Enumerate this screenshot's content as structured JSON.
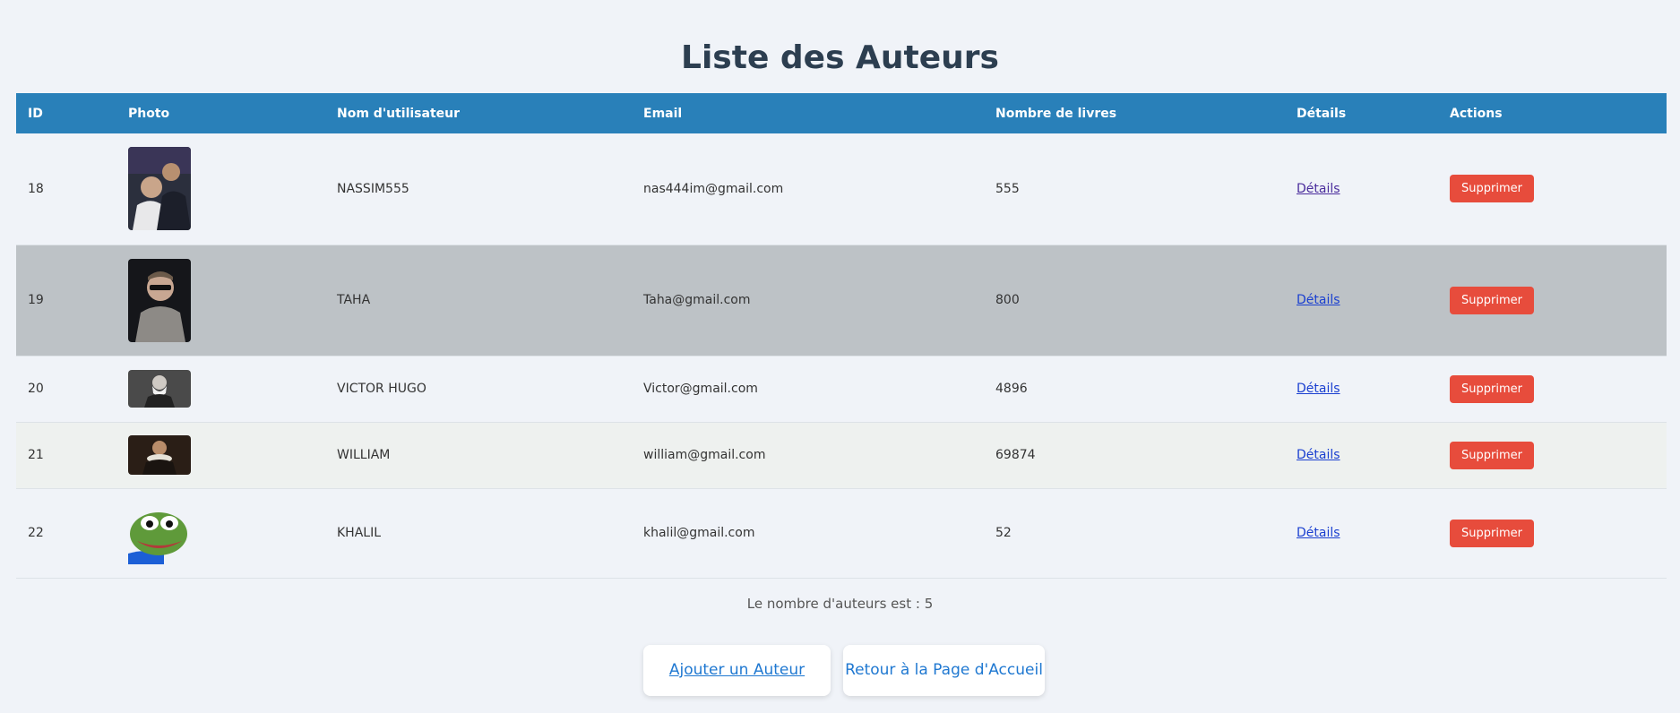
{
  "page_title": "Liste des Auteurs",
  "table": {
    "headers": [
      "ID",
      "Photo",
      "Nom d'utilisateur",
      "Email",
      "Nombre de livres",
      "Détails",
      "Actions"
    ],
    "rows": [
      {
        "id": "18",
        "username": "NASSIM555",
        "email": "nas444im@gmail.com",
        "books": "555",
        "details": "Détails",
        "action": "Supprimer"
      },
      {
        "id": "19",
        "username": "TAHA",
        "email": "Taha@gmail.com",
        "books": "800",
        "details": "Détails",
        "action": "Supprimer"
      },
      {
        "id": "20",
        "username": "VICTOR HUGO",
        "email": "Victor@gmail.com",
        "books": "4896",
        "details": "Détails",
        "action": "Supprimer"
      },
      {
        "id": "21",
        "username": "WILLIAM",
        "email": "william@gmail.com",
        "books": "69874",
        "details": "Détails",
        "action": "Supprimer"
      },
      {
        "id": "22",
        "username": "KHALIL",
        "email": "khalil@gmail.com",
        "books": "52",
        "details": "Détails",
        "action": "Supprimer"
      }
    ]
  },
  "count_text": "Le nombre d'auteurs est : 5",
  "buttons": {
    "add": "Ajouter un Auteur",
    "home": "Retour à la Page d'Accueil"
  },
  "colors": {
    "header_bg": "#2980b9",
    "delete_button": "#e74c3c",
    "highlight_row": "#bdc2c6",
    "title": "#2c3e50"
  }
}
